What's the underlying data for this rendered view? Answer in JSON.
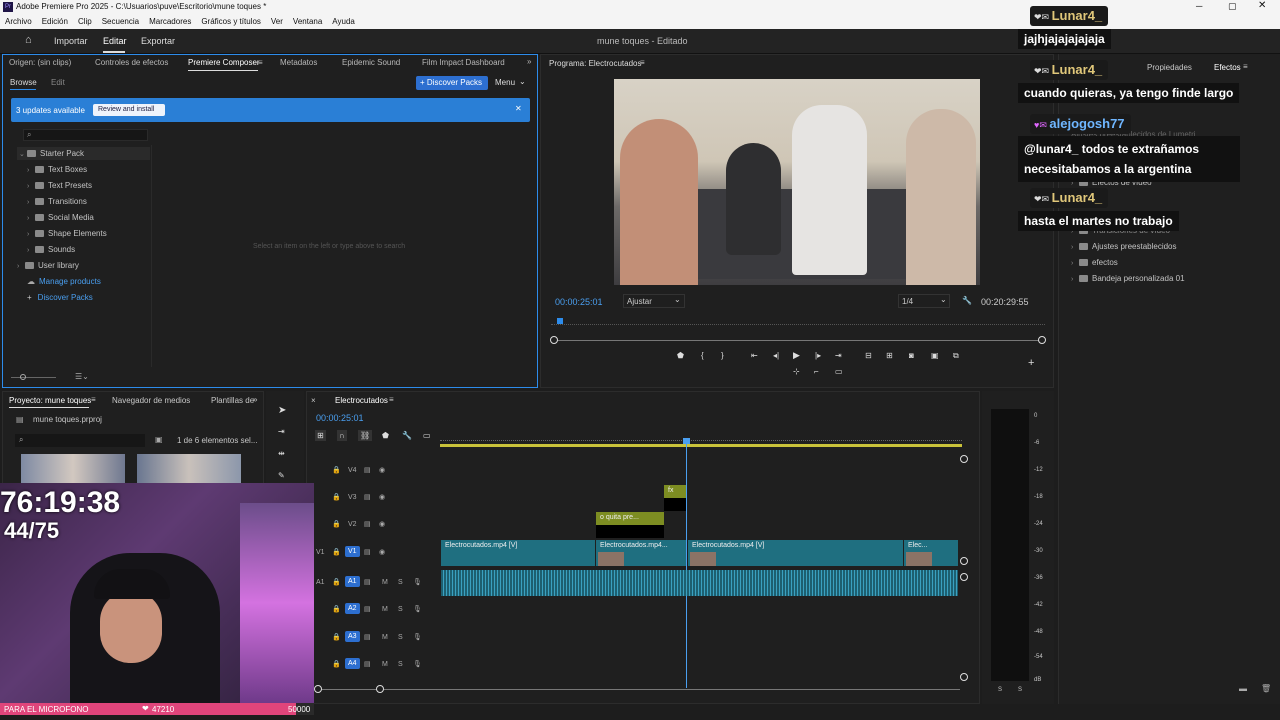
{
  "app": {
    "title": "Adobe Premiere Pro 2025 - C:\\Usuarios\\puve\\Escritorio\\mune toques *",
    "menu": [
      "Archivo",
      "Edición",
      "Clip",
      "Secuencia",
      "Marcadores",
      "Gráficos y títulos",
      "Ver",
      "Ventana",
      "Ayuda"
    ],
    "workspaces": {
      "import": "Importar",
      "edit": "Editar",
      "export": "Exportar"
    },
    "project_status": "mune toques - Editado"
  },
  "source_panel": {
    "tabs": [
      "Origen: (sin clips)",
      "Controles de efectos",
      "Premiere Composer",
      "Metadatos",
      "Epidemic Sound",
      "Film Impact Dashboard"
    ],
    "subtabs": {
      "browse": "Browse",
      "edit": "Edit"
    },
    "discover_button": "+ Discover Packs",
    "menu_button": "Menu",
    "banner": {
      "text": "3 updates available",
      "action": "Review and install"
    },
    "tree": {
      "root": "Starter Pack",
      "children": [
        "Text Boxes",
        "Text Presets",
        "Transitions",
        "Social Media",
        "Shape Elements",
        "Sounds"
      ],
      "user_library": "User library",
      "manage": "Manage products",
      "discover": "Discover Packs"
    },
    "empty_hint": "Select an item on the left or type above to search"
  },
  "program_monitor": {
    "title": "Programa: Electrocutados",
    "timecode": "00:00:25:01",
    "fit": "Ajustar",
    "quality": "1/4",
    "duration": "00:20:29:55"
  },
  "effects_panel": {
    "tabs": {
      "properties": "Propiedades",
      "effects": "Efectos"
    },
    "items": [
      "Ajustes preestablecidos de Lumetri",
      "Efectos de vídeo",
      "Transiciones de vídeo",
      "Ajustes preestablecidos",
      "efectos",
      "Bandeja personalizada 01"
    ]
  },
  "project_panel": {
    "tabs": [
      "Proyecto: mune toques",
      "Navegador de medios",
      "Plantillas de"
    ],
    "file": "mune toques.prproj",
    "count": "1 de 6 elementos sel..."
  },
  "timeline": {
    "sequence": "Electrocutados",
    "timecode": "00:00:25:01",
    "video_tracks": [
      "V4",
      "V3",
      "V2",
      "V1"
    ],
    "audio_tracks": [
      "A1",
      "A2",
      "A3",
      "A4"
    ],
    "clips": {
      "v1_a": "Electrocutados.mp4 [V]",
      "v1_b": "Electrocutados.mp4...",
      "v1_c": "Electrocutados.mp4 [V]",
      "v1_d": "Elec...",
      "v2": "o quita pre..."
    },
    "meter_ticks": [
      "0",
      "-6",
      "-12",
      "-18",
      "-24",
      "-30",
      "-36",
      "-42",
      "-48",
      "-54",
      "dB"
    ]
  },
  "webcam": {
    "timer": "76:19:38",
    "counter": "44/75",
    "goal_label": "PARA EL MICROFONO",
    "goal_current": "47210",
    "goal_target": "50000",
    "goal_progress": 0.944
  },
  "chat": [
    {
      "user": "Lunar4_",
      "message": "jajhjajajajajaja"
    },
    {
      "user": "Lunar4_",
      "message": "cuando quieras, ya tengo finde largo"
    },
    {
      "user": "alejogosh77",
      "message": "@lunar4_ todos te extrañamos necesitabamos a la argentina"
    },
    {
      "user": "Lunar4_",
      "message": "hasta el martes no trabajo"
    }
  ],
  "colors": {
    "accent": "#2d8ceb",
    "timeline_bar": "#c9c23a",
    "clip_video": "#1f6f80",
    "clip_audio": "#1d5f70",
    "goal": "#e0457b"
  }
}
